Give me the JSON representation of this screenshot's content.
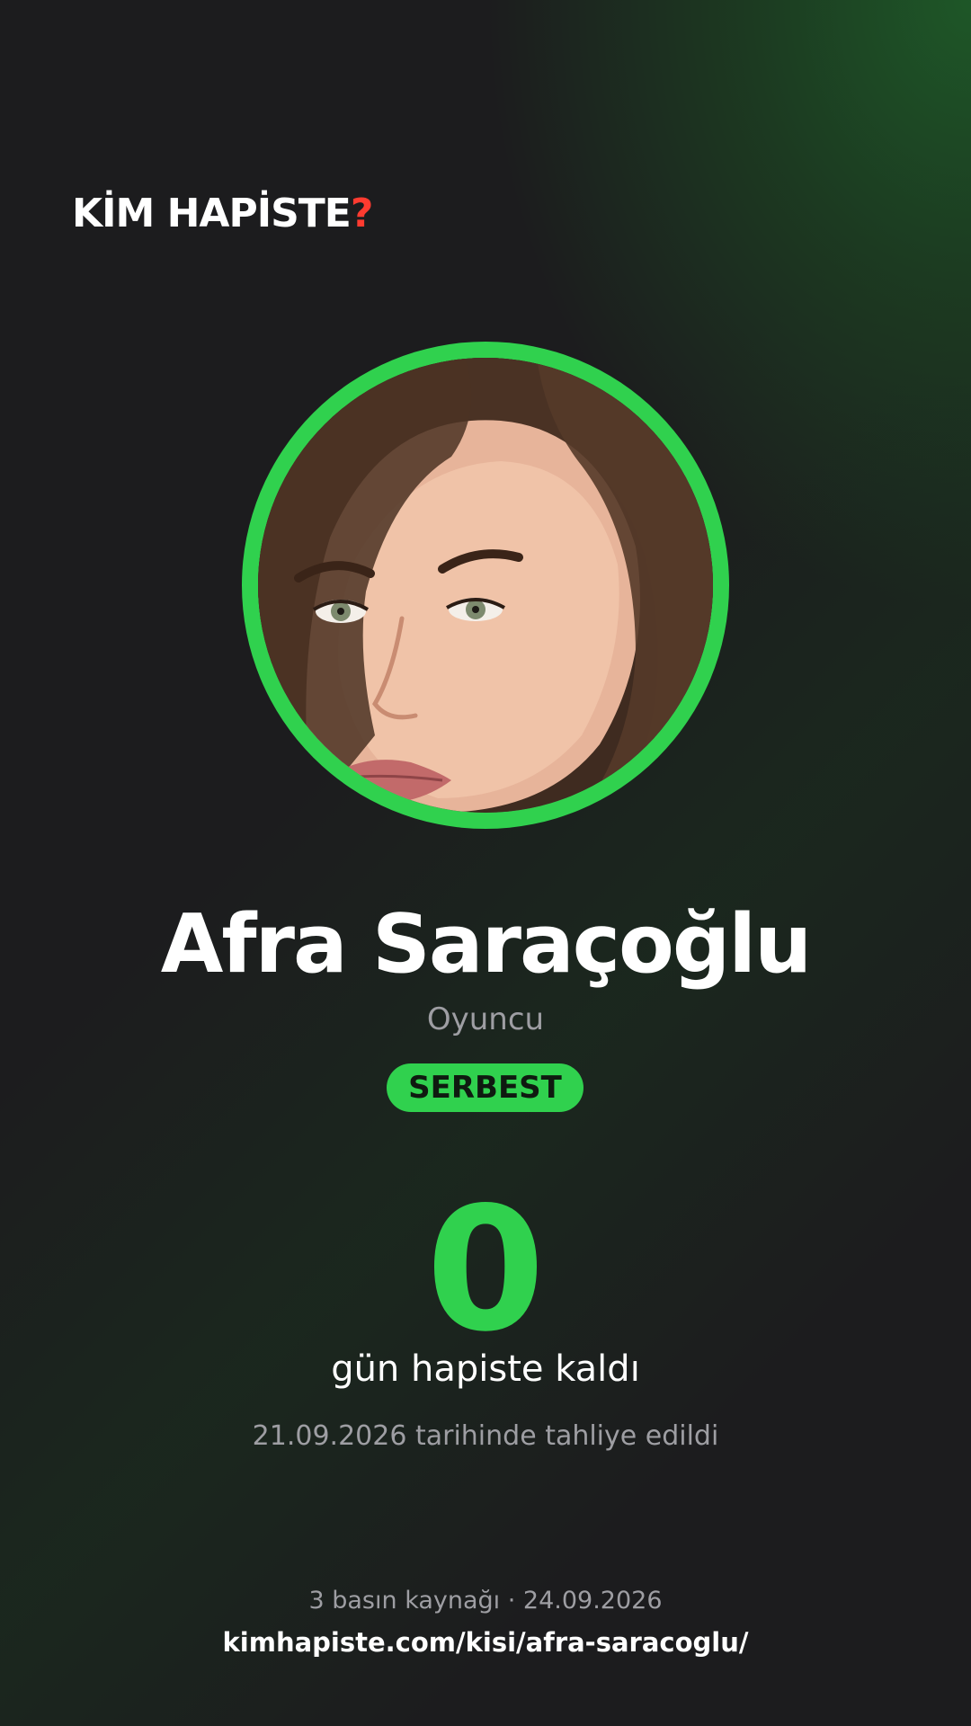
{
  "brand": {
    "logo_text": "KİM HAPİSTE",
    "logo_mark": "?",
    "accent_color": "#30d14e",
    "mark_color": "#ff3b30",
    "background_color": "#1c1c1e"
  },
  "person": {
    "name": "Afra Saraçoğlu",
    "role": "Oyuncu",
    "avatar_icon": "portrait-photo"
  },
  "status": {
    "label": "SERBEST"
  },
  "counter": {
    "days": "0",
    "label": "gün hapiste kaldı"
  },
  "release": {
    "note": "21.09.2026 tarihinde tahliye edildi"
  },
  "footer": {
    "sources": "3 basın kaynağı · 24.09.2026",
    "url": "kimhapiste.com/kisi/afra-saracoglu/"
  }
}
